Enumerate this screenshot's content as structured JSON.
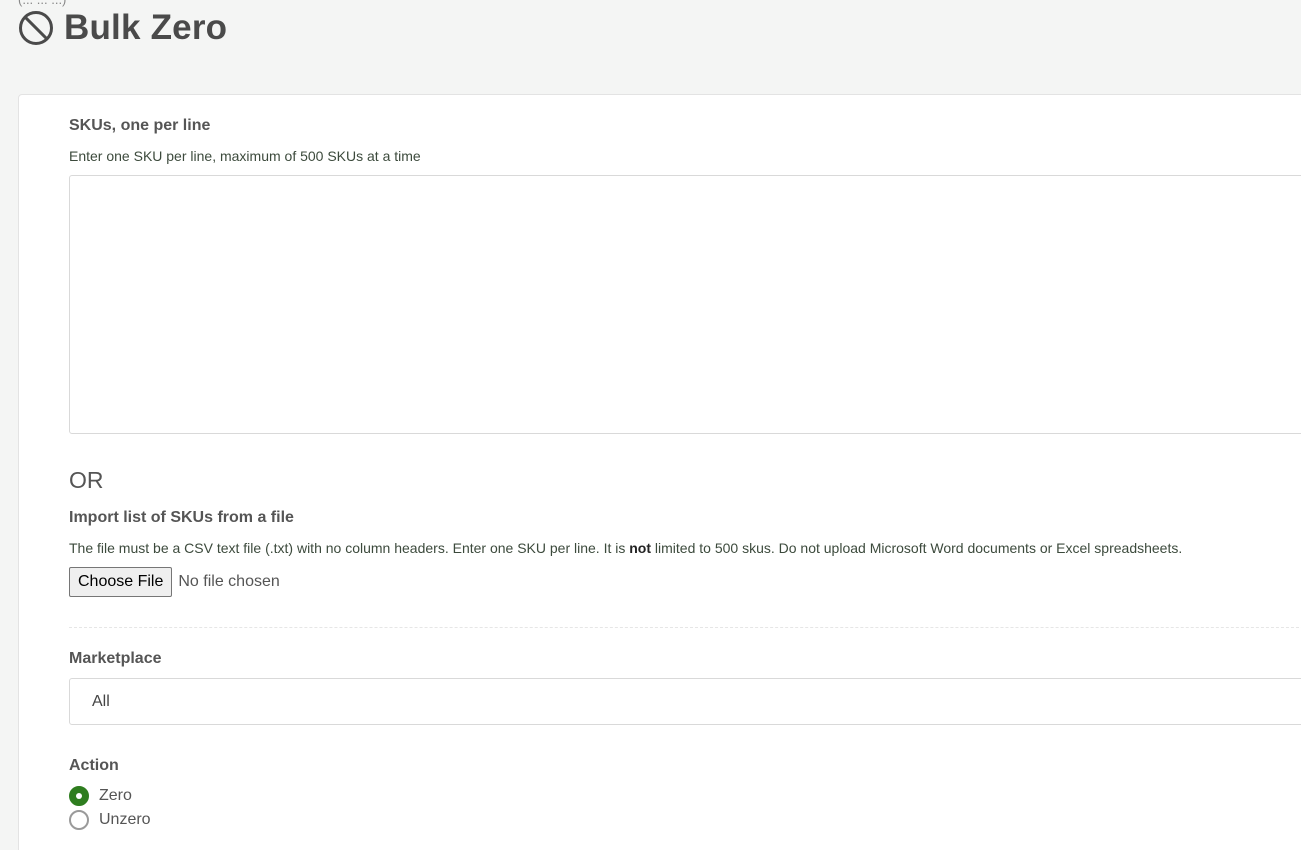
{
  "header": {
    "breadcrumb": "(... ... ...)",
    "title": "Bulk Zero",
    "icon": "prohibited-icon"
  },
  "skus": {
    "label": "SKUs, one per line",
    "help": "Enter one SKU per line, maximum of 500 SKUs at a time",
    "value": ""
  },
  "or_text": "OR",
  "import": {
    "label": "Import list of SKUs from a file",
    "help_before": "The file must be a CSV text file (.txt) with no column headers. Enter one SKU per line. It is ",
    "help_bold": "not",
    "help_after": " limited to 500 skus. Do not upload Microsoft Word documents or Excel spreadsheets.",
    "button_label": "Choose File",
    "status": "No file chosen"
  },
  "marketplace": {
    "label": "Marketplace",
    "selected": "All"
  },
  "action": {
    "label": "Action",
    "options": [
      {
        "label": "Zero",
        "selected": true
      },
      {
        "label": "Unzero",
        "selected": false
      }
    ]
  },
  "colors": {
    "accent": "#2e7d1f",
    "background": "#f4f5f4"
  }
}
